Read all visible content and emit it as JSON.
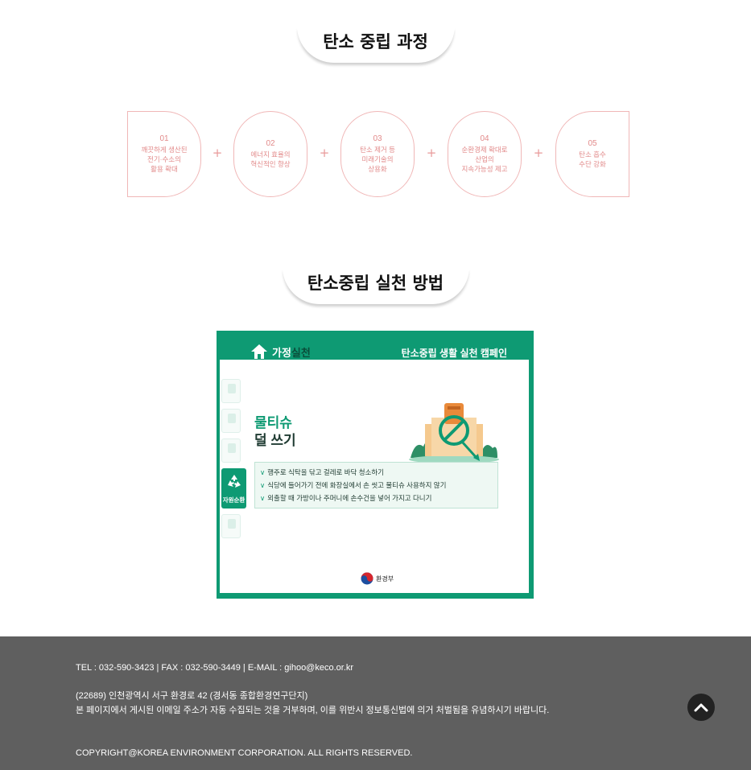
{
  "section_process": {
    "title": "탄소 중립 과정",
    "steps": [
      {
        "num": "01",
        "text": "깨끗하게 생산된\n전기·수소의\n활용 확대"
      },
      {
        "num": "02",
        "text": "에너지 효율의\n혁신적인 향상"
      },
      {
        "num": "03",
        "text": "탄소 제거 등\n미래기술의\n상용화"
      },
      {
        "num": "04",
        "text": "순환경제 확대로\n산업의\n지속가능성 제고"
      },
      {
        "num": "05",
        "text": "탄소 흡수\n수단 강화"
      }
    ],
    "plus": "+"
  },
  "section_practice": {
    "title": "탄소중립 실천 방법",
    "card": {
      "category_main": "가정",
      "category_sub": "실천",
      "campaign": "탄소중립 생활 실천 캠페인",
      "headline_line1": "물티슈",
      "headline_line2": "덜 쓰기",
      "side_active_label": "자원순환",
      "tips": [
        "행주로 식탁을 닦고 걸레로 바닥 청소하기",
        "식당에 들어가기 전에 화장실에서 손 씻고 물티슈 사용하지 않기",
        "외출할 때 가방이나 주머니에 손수건을 넣어 가지고 다니기"
      ],
      "tip_marker": "∨",
      "ministry": "환경부"
    },
    "colors": {
      "accent": "#0e9a73",
      "pink": "#e28a8a"
    }
  },
  "footer": {
    "contact": "TEL : 032-590-3423 | FAX : 032-590-3449 | E-MAIL : gihoo@keco.or.kr",
    "address": "(22689) 인천광역시 서구 환경로 42 (경서동 종합환경연구단지)",
    "notice": "본 페이지에서 게시된 이메일 주소가 자동 수집되는 것을 거부하며, 이를 위반시 정보통신법에 의거 처벌됨을 유념하시기 바랍니다.",
    "copyright": "COPYRIGHT@KOREA ENVIRONMENT CORPORATION. ALL RIGHTS RESERVED.",
    "top_button_icon": "chevron-up-icon"
  }
}
